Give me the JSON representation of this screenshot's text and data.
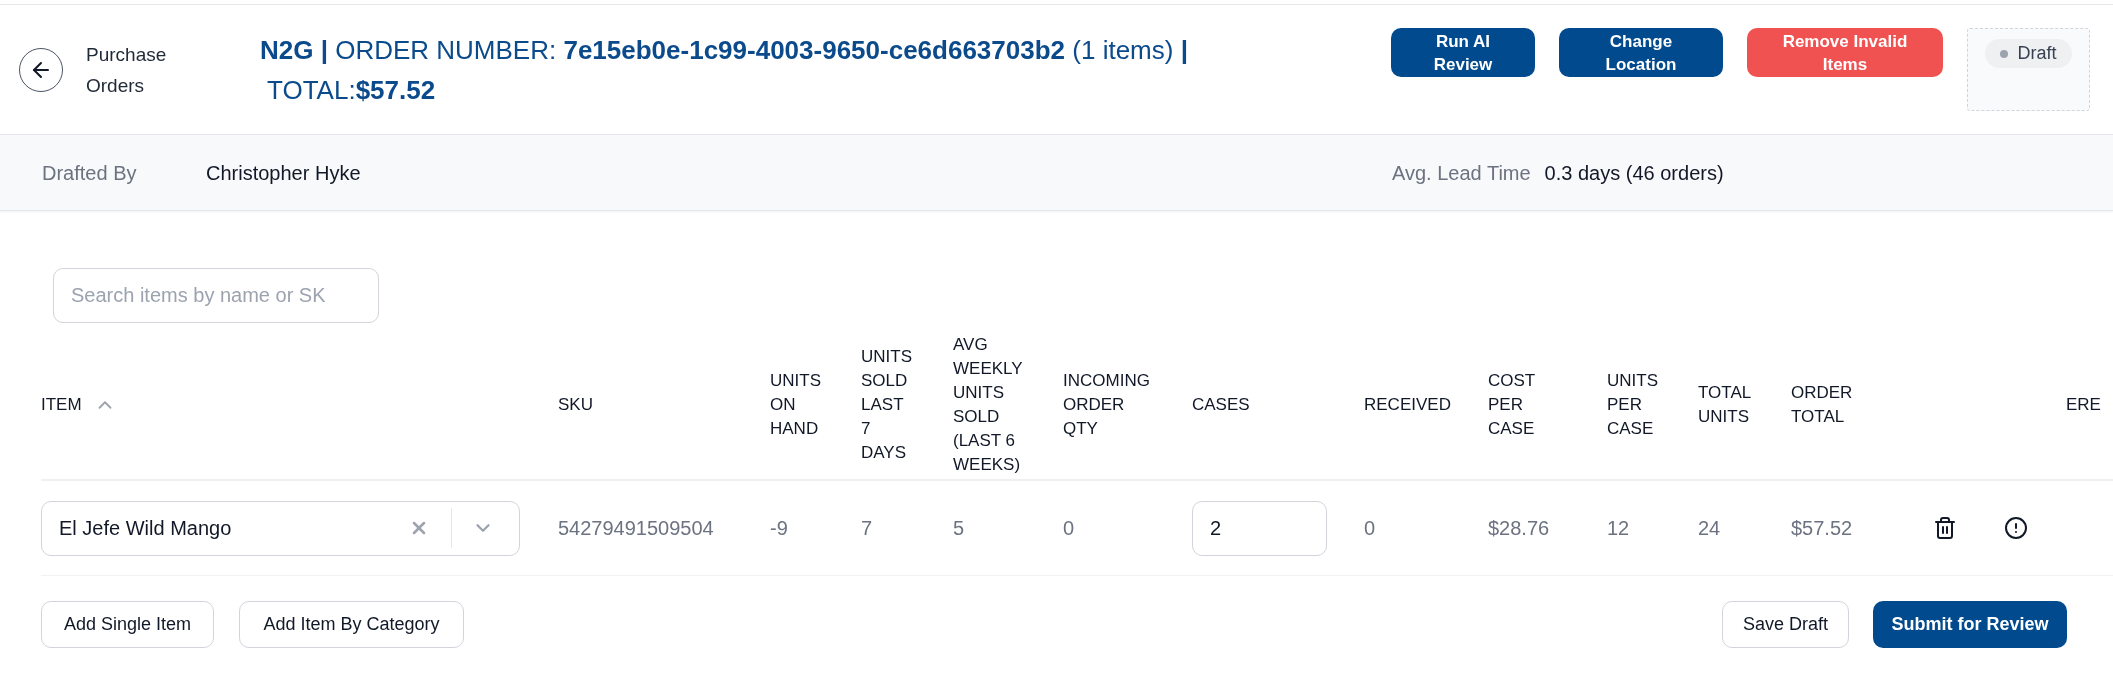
{
  "header": {
    "back_label": "Purchase Orders",
    "title_lines": [
      "**N2G |** ORDER NUMBER: **7e15eb0e-1c99-4003-9650-ce6d663703b2** (1 items) **|**",
      "TOTAL:**$57.52**"
    ],
    "actions": [
      {
        "label": "Run AI Review",
        "kind": "primary"
      },
      {
        "label": "Change Location",
        "kind": "primary"
      },
      {
        "label": "Remove Invalid Items",
        "kind": "danger"
      }
    ],
    "status": {
      "label": "Draft"
    }
  },
  "info_bar": {
    "fields": [
      {
        "label": "Drafted By",
        "value": "Christopher Hyke"
      },
      {
        "label": "Avg. Lead Time",
        "value": "0.3 days (46 orders)"
      }
    ]
  },
  "search": {
    "placeholder": "Search items by name or SK"
  },
  "table": {
    "columns": [
      {
        "label": "ITEM",
        "sorted_ascending": true
      },
      {
        "label": "SKU"
      },
      {
        "label": "UNITS ON HAND"
      },
      {
        "label": "UNITS SOLD LAST 7 DAYS"
      },
      {
        "label": "AVG WEEKLY UNITS SOLD (LAST 6 WEEKS)"
      },
      {
        "label": "INCOMING ORDER QTY"
      },
      {
        "label": "CASES"
      },
      {
        "label": "RECEIVED"
      },
      {
        "label": "COST PER CASE"
      },
      {
        "label": "UNITS PER CASE"
      },
      {
        "label": "TOTAL UNITS"
      },
      {
        "label": "ORDER TOTAL"
      },
      {
        "label": "ERE"
      }
    ],
    "rows": [
      {
        "item": "El Jefe Wild Mango",
        "sku": "54279491509504",
        "units_on_hand": "-9",
        "units_sold_last_7_days": "7",
        "avg_weekly_units_sold": "5",
        "incoming_order_qty": "0",
        "cases": "2",
        "received": "0",
        "cost_per_case": "$28.76",
        "units_per_case": "12",
        "total_units": "24",
        "order_total": "$57.52"
      }
    ]
  },
  "footer": {
    "left_buttons": [
      "Add Single Item",
      "Add Item By Category"
    ],
    "right_buttons": [
      {
        "label": "Save Draft",
        "kind": "secondary"
      },
      {
        "label": "Submit for Review",
        "kind": "primary"
      }
    ]
  }
}
